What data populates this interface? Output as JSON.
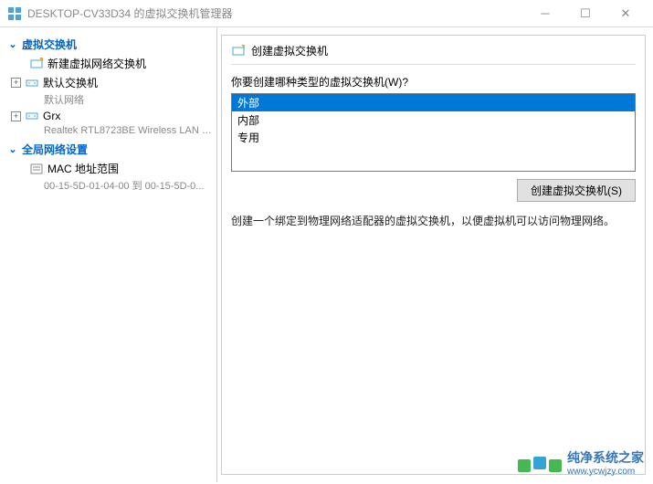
{
  "titlebar": {
    "title": "DESKTOP-CV33D34 的虚拟交换机管理器"
  },
  "sidebar": {
    "section1": {
      "title": "虚拟交换机",
      "new_switch": "新建虚拟网络交换机",
      "items": [
        {
          "name": "默认交换机",
          "sub": "默认网络"
        },
        {
          "name": "Grx",
          "sub": "Realtek RTL8723BE Wireless LAN 8..."
        }
      ]
    },
    "section2": {
      "title": "全局网络设置",
      "mac_label": "MAC 地址范围",
      "mac_range": "00-15-5D-01-04-00 到 00-15-5D-0..."
    }
  },
  "content": {
    "header": "创建虚拟交换机",
    "question": "你要创建哪种类型的虚拟交换机(W)?",
    "options": [
      "外部",
      "内部",
      "专用"
    ],
    "create_button": "创建虚拟交换机(S)",
    "description": "创建一个绑定到物理网络适配器的虚拟交换机，以便虚拟机可以访问物理网络。"
  },
  "watermark": {
    "brand": "纯净系统之家",
    "url": "www.ycwjzy.com"
  }
}
